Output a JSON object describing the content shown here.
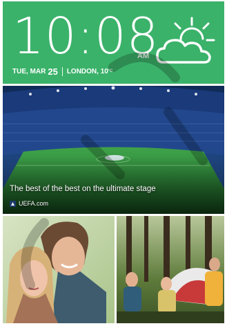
{
  "clock": {
    "time": "10:08",
    "ampm": "AM",
    "weekday_month": "TUE, MAR",
    "day": "25",
    "city_temp": "LONDON, 10",
    "temp_unit": "°C",
    "weather_icon": "partly-cloudy-icon"
  },
  "news": {
    "headline": "The best of the best on the ultimate stage",
    "source": "UEFA.com"
  },
  "colors": {
    "accent_green": "#3bb26a",
    "pitch_green": "#2f8d3e",
    "stadium_blue": "#1b3a6b"
  }
}
